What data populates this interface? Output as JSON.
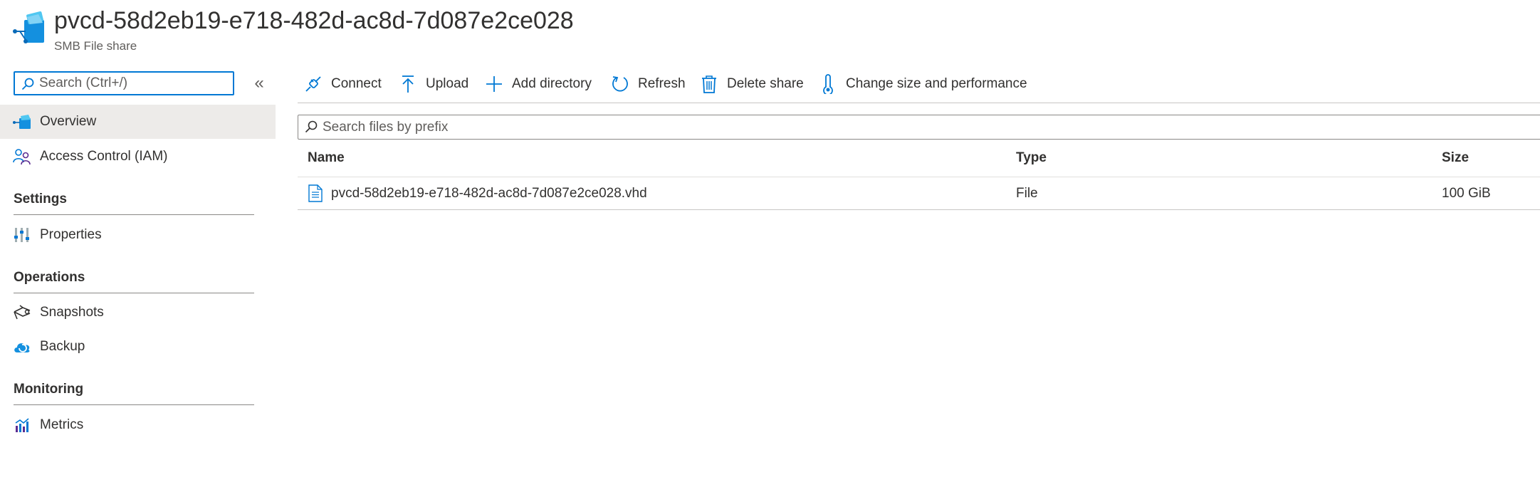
{
  "header": {
    "title": "pvcd-58d2eb19-e718-482d-ac8d-7d087e2ce028",
    "subtitle": "SMB File share",
    "icon": "file-share-icon"
  },
  "sidebar": {
    "search": {
      "placeholder": "Search (Ctrl+/)",
      "value": ""
    },
    "collapse_label": "«",
    "items": [
      {
        "label": "Overview",
        "icon": "file-share-icon",
        "selected": true
      },
      {
        "label": "Access Control (IAM)",
        "icon": "people-icon"
      }
    ],
    "sections": [
      {
        "title": "Settings",
        "items": [
          {
            "label": "Properties",
            "icon": "properties-icon"
          }
        ]
      },
      {
        "title": "Operations",
        "items": [
          {
            "label": "Snapshots",
            "icon": "snapshot-icon"
          },
          {
            "label": "Backup",
            "icon": "backup-cloud-icon"
          }
        ]
      },
      {
        "title": "Monitoring",
        "items": [
          {
            "label": "Metrics",
            "icon": "metrics-icon"
          }
        ]
      }
    ]
  },
  "toolbar": {
    "connect": "Connect",
    "upload": "Upload",
    "add_directory": "Add directory",
    "refresh": "Refresh",
    "delete_share": "Delete share",
    "change_size": "Change size and performance"
  },
  "file_search": {
    "placeholder": "Search files by prefix",
    "value": ""
  },
  "table": {
    "columns": [
      "Name",
      "Type",
      "Size"
    ],
    "rows": [
      {
        "name": "pvcd-58d2eb19-e718-482d-ac8d-7d087e2ce028.vhd",
        "type": "File",
        "size": "100 GiB",
        "icon": "file-icon"
      }
    ]
  },
  "colors": {
    "accent": "#0078d4",
    "selected_bg": "#edebe9",
    "text": "#323130",
    "subtle_text": "#605e5c"
  }
}
